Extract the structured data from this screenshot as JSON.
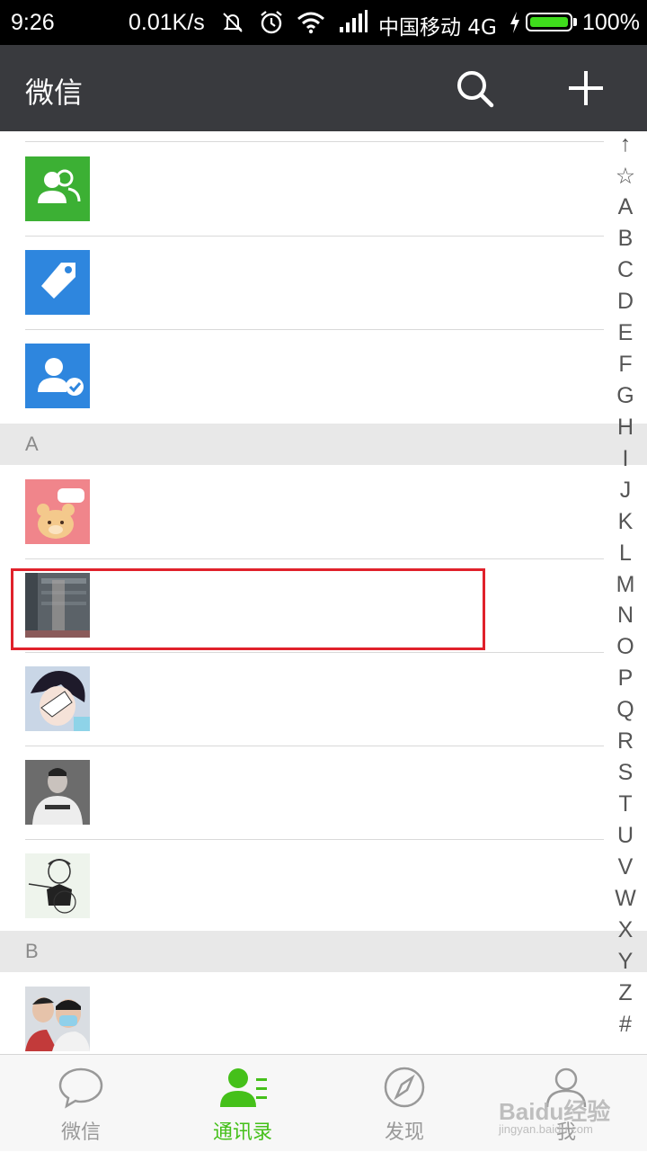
{
  "status_bar": {
    "time": "9:26",
    "net_speed": "0.01K/s",
    "carrier": "中国移动 4G",
    "battery_percent": "100%",
    "battery_level": 1.0,
    "icons": [
      "mute-vibrate-icon",
      "alarm-icon",
      "wifi-icon",
      "signal-icon",
      "charging-icon",
      "battery-icon"
    ]
  },
  "header": {
    "title": "微信",
    "actions": [
      "search-icon",
      "plus-icon"
    ]
  },
  "contacts": {
    "special_entries": [
      {
        "icon": "group-chat-icon",
        "color": "#3cb034"
      },
      {
        "icon": "tag-icon",
        "color": "#2e86de"
      },
      {
        "icon": "official-account-icon",
        "color": "#2e86de"
      }
    ],
    "sections": [
      {
        "letter": "A",
        "count": 5
      },
      {
        "letter": "B",
        "count": 1
      }
    ]
  },
  "index_bar": [
    "↑",
    "☆",
    "A",
    "B",
    "C",
    "D",
    "E",
    "F",
    "G",
    "H",
    "I",
    "J",
    "K",
    "L",
    "M",
    "N",
    "O",
    "P",
    "Q",
    "R",
    "S",
    "T",
    "U",
    "V",
    "W",
    "X",
    "Y",
    "Z",
    "#"
  ],
  "tabs": [
    {
      "label": "微信",
      "icon": "chat-bubble-icon",
      "active": false
    },
    {
      "label": "通讯录",
      "icon": "contacts-icon",
      "active": true
    },
    {
      "label": "发现",
      "icon": "compass-icon",
      "active": false
    },
    {
      "label": "我",
      "icon": "person-icon",
      "active": false
    }
  ],
  "watermark": {
    "brand": "Baidu经验",
    "url": "jingyan.baidu.com"
  },
  "colors": {
    "accent_green": "#45c01a",
    "header_bg": "#393a3e",
    "highlight_red": "#e0212b"
  }
}
